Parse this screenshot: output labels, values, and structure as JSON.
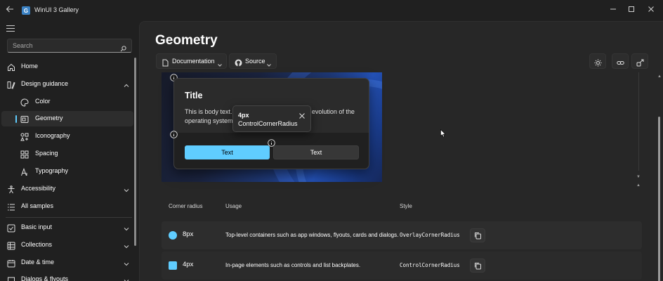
{
  "window": {
    "title": "WinUI 3 Gallery",
    "app_icon_glyph": "G"
  },
  "sidebar": {
    "search_placeholder": "Search",
    "items": [
      {
        "label": "Home",
        "icon": "home-icon"
      },
      {
        "label": "Design guidance",
        "icon": "ruler-pen-icon",
        "expanded": true
      },
      {
        "label": "Color",
        "icon": "palette-icon"
      },
      {
        "label": "Geometry",
        "icon": "geometry-icon",
        "selected": true
      },
      {
        "label": "Iconography",
        "icon": "shapes-icon"
      },
      {
        "label": "Spacing",
        "icon": "grid-icon"
      },
      {
        "label": "Typography",
        "icon": "font-icon"
      },
      {
        "label": "Accessibility",
        "icon": "accessibility-icon"
      },
      {
        "label": "All samples",
        "icon": "list-icon"
      },
      {
        "label": "Basic input",
        "icon": "checkbox-icon"
      },
      {
        "label": "Collections",
        "icon": "table-icon"
      },
      {
        "label": "Date & time",
        "icon": "calendar-icon"
      },
      {
        "label": "Dialogs & flyouts",
        "icon": "chat-icon"
      }
    ]
  },
  "header": {
    "page_title": "Geometry",
    "documentation_label": "Documentation",
    "source_label": "Source"
  },
  "example": {
    "dialog_title": "Title",
    "dialog_body": "This is body text. Windows 11 marks a visual evolution of the operating system.",
    "primary_button": "Text",
    "secondary_button": "Text",
    "tooltip_value": "4px",
    "tooltip_name": "ControlCornerRadius"
  },
  "table": {
    "headers": {
      "corner_radius": "Corner radius",
      "usage": "Usage",
      "style": "Style"
    },
    "rows": [
      {
        "radius": "8px",
        "usage": "Top-level containers such as app windows, flyouts, cards and dialogs.",
        "style": "OverlayCornerRadius",
        "swatch_shape": "circle"
      },
      {
        "radius": "4px",
        "usage": "In-page elements such as controls and list backplates.",
        "style": "ControlCornerRadius",
        "swatch_shape": "rounded-square"
      }
    ]
  },
  "colors": {
    "accent": "#60cdff",
    "background": "#202020",
    "content_background": "#272727"
  }
}
